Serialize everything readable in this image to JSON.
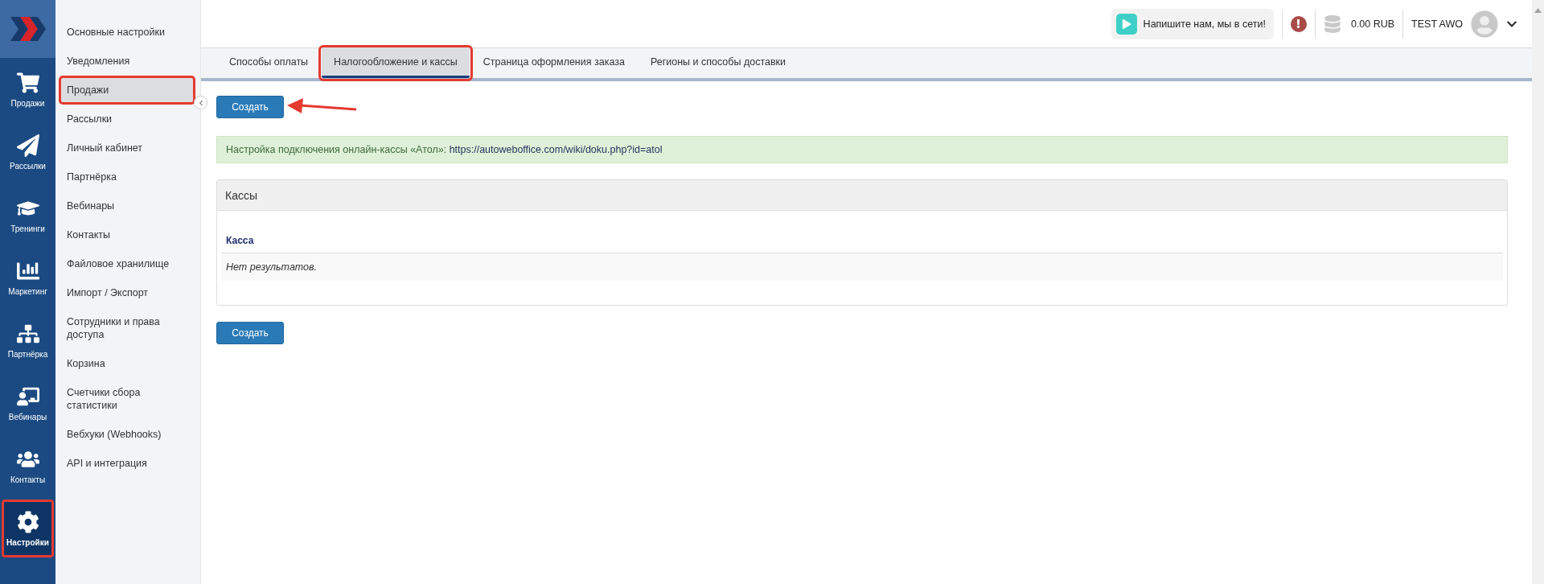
{
  "rail": {
    "items": [
      {
        "label": "Продажи",
        "selected": false,
        "annotated": false
      },
      {
        "label": "Рассылки",
        "selected": false,
        "annotated": false
      },
      {
        "label": "Тренинги",
        "selected": false,
        "annotated": false
      },
      {
        "label": "Маркетинг",
        "selected": false,
        "annotated": false
      },
      {
        "label": "Партнёрка",
        "selected": false,
        "annotated": false
      },
      {
        "label": "Вебинары",
        "selected": false,
        "annotated": false
      },
      {
        "label": "Контакты",
        "selected": false,
        "annotated": false
      },
      {
        "label": "Настройки",
        "selected": true,
        "annotated": true
      }
    ]
  },
  "sidebar": {
    "items": [
      {
        "label": "Основные настройки",
        "selected": false,
        "annotated": false
      },
      {
        "label": "Уведомления",
        "selected": false,
        "annotated": false
      },
      {
        "label": "Продажи",
        "selected": true,
        "annotated": true
      },
      {
        "label": "Рассылки",
        "selected": false,
        "annotated": false
      },
      {
        "label": "Личный кабинет",
        "selected": false,
        "annotated": false
      },
      {
        "label": "Партнёрка",
        "selected": false,
        "annotated": false
      },
      {
        "label": "Вебинары",
        "selected": false,
        "annotated": false
      },
      {
        "label": "Контакты",
        "selected": false,
        "annotated": false
      },
      {
        "label": "Файловое хранилище",
        "selected": false,
        "annotated": false
      },
      {
        "label": "Импорт / Экспорт",
        "selected": false,
        "annotated": false
      },
      {
        "label": "Сотрудники и права доступа",
        "selected": false,
        "annotated": false
      },
      {
        "label": "Корзина",
        "selected": false,
        "annotated": false
      },
      {
        "label": "Счетчики сбора статистики",
        "selected": false,
        "annotated": false
      },
      {
        "label": "Вебхуки (Webhooks)",
        "selected": false,
        "annotated": false
      },
      {
        "label": "API и интеграция",
        "selected": false,
        "annotated": false
      }
    ]
  },
  "topbar": {
    "chat": "Напишите нам, мы в сети!",
    "balance": "0.00 RUB",
    "user": "TEST AWO"
  },
  "tabs": [
    {
      "label": "Способы оплаты",
      "selected": false,
      "annotated": false
    },
    {
      "label": "Налогообложение и кассы",
      "selected": true,
      "annotated": true
    },
    {
      "label": "Страница оформления заказа",
      "selected": false,
      "annotated": false
    },
    {
      "label": "Регионы и способы доставки",
      "selected": false,
      "annotated": false
    }
  ],
  "create_top": {
    "label": "Создать",
    "annotated": true
  },
  "alert": {
    "text": "Настройка подключения онлайн-кассы «Атол»:",
    "link": "https://autoweboffice.com/wiki/doku.php?id=atol"
  },
  "panel": {
    "title": "Кассы",
    "columns": [
      "Касса"
    ],
    "empty": "Нет результатов."
  },
  "create_bottom": {
    "label": "Создать"
  }
}
